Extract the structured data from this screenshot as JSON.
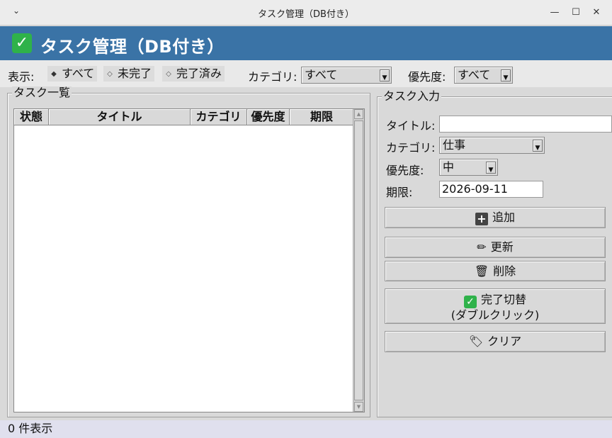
{
  "window": {
    "title": "タスク管理（DB付き）"
  },
  "header": {
    "title": "タスク管理（DB付き）"
  },
  "filter": {
    "display_label": "表示:",
    "options": [
      {
        "label": "すべて",
        "selected": true
      },
      {
        "label": "未完了",
        "selected": false
      },
      {
        "label": "完了済み",
        "selected": false
      }
    ],
    "category_label": "カテゴリ:",
    "category_value": "すべて",
    "priority_label": "優先度:",
    "priority_value": "すべて"
  },
  "task_list": {
    "title": "タスク一覧",
    "columns": [
      "状態",
      "タイトル",
      "カテゴリ",
      "優先度",
      "期限"
    ],
    "rows": []
  },
  "task_input": {
    "title": "タスク入力",
    "title_label": "タイトル:",
    "title_value": "",
    "category_label": "カテゴリ:",
    "category_value": "仕事",
    "priority_label": "優先度:",
    "priority_value": "中",
    "due_label": "期限:",
    "due_value": "2026-09-11",
    "buttons": {
      "add": "追加",
      "update": "更新",
      "delete": "削除",
      "toggle_line1": "完了切替",
      "toggle_line2": "(ダブルクリック)",
      "clear": "クリア"
    }
  },
  "status": {
    "text": "0 件表示"
  },
  "icons": {
    "menu": "chevron-down-icon",
    "check": "check-mark-icon",
    "add": "plus-icon",
    "update": "pencil-icon",
    "delete": "trash-icon",
    "clear": "tag-icon"
  },
  "colors": {
    "banner": "#3a73a6",
    "status_bar": "#e0e0ee",
    "check": "#2fb24a"
  }
}
